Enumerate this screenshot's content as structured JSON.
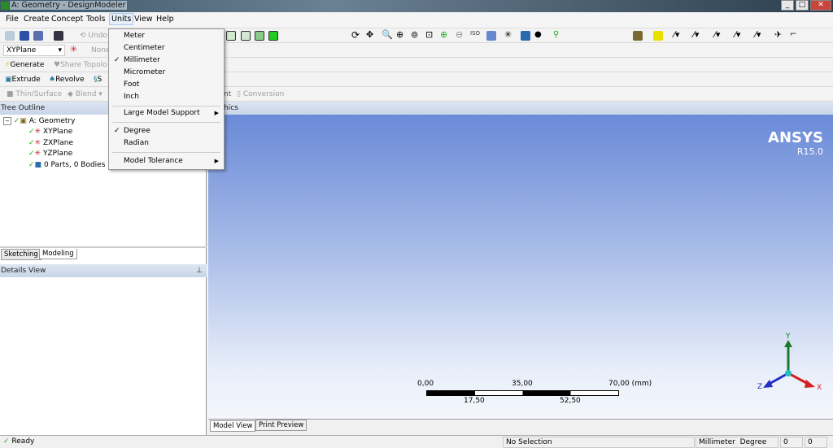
{
  "window": {
    "title": "A: Geometry - DesignModeler"
  },
  "menubar": [
    "File",
    "Create",
    "Concept",
    "Tools",
    "Units",
    "View",
    "Help"
  ],
  "toolbar": {
    "undo": "Undo",
    "plane": "XYPlane",
    "sketch": "None",
    "generate": "Generate",
    "share": "Share Topolo",
    "extrude": "Extrude",
    "revolve": "Revolve",
    "sweep": "S",
    "thin": "Thin/Surface",
    "blend": "Blend",
    "point": "nt",
    "conversion": "Conversion"
  },
  "units_menu": {
    "items": [
      "Meter",
      "Centimeter",
      "Millimeter",
      "Micrometer",
      "Foot",
      "Inch"
    ],
    "checked_length": "Millimeter",
    "large_model": "Large Model Support",
    "angles": [
      "Degree",
      "Radian"
    ],
    "checked_angle": "Degree",
    "tolerance": "Model Tolerance"
  },
  "tree": {
    "header": "Tree Outline",
    "root": "A: Geometry",
    "children": [
      "XYPlane",
      "ZXPlane",
      "YZPlane",
      "0 Parts, 0 Bodies"
    ]
  },
  "left_tabs": [
    "Sketching",
    "Modeling"
  ],
  "details": {
    "header": "Details View"
  },
  "graphics": {
    "header": "hics",
    "brand": "ANSYS",
    "version": "R15.0",
    "scale": {
      "top": [
        "0,00",
        "35,00",
        "70,00 (mm)"
      ],
      "bottom": [
        "17,50",
        "52,50"
      ]
    },
    "axes": {
      "x": "X",
      "y": "Y",
      "z": "Z"
    }
  },
  "view_tabs": [
    "Model View",
    "Print Preview"
  ],
  "status": {
    "ready": "Ready",
    "selection": "No Selection",
    "length_unit": "Millimeter",
    "angle_unit": "Degree",
    "v1": "0",
    "v2": "0"
  },
  "colors": {
    "accent": "#a9c6ea",
    "x_axis": "#d42020",
    "y_axis": "#1a7a2a",
    "z_axis": "#2030c0"
  }
}
